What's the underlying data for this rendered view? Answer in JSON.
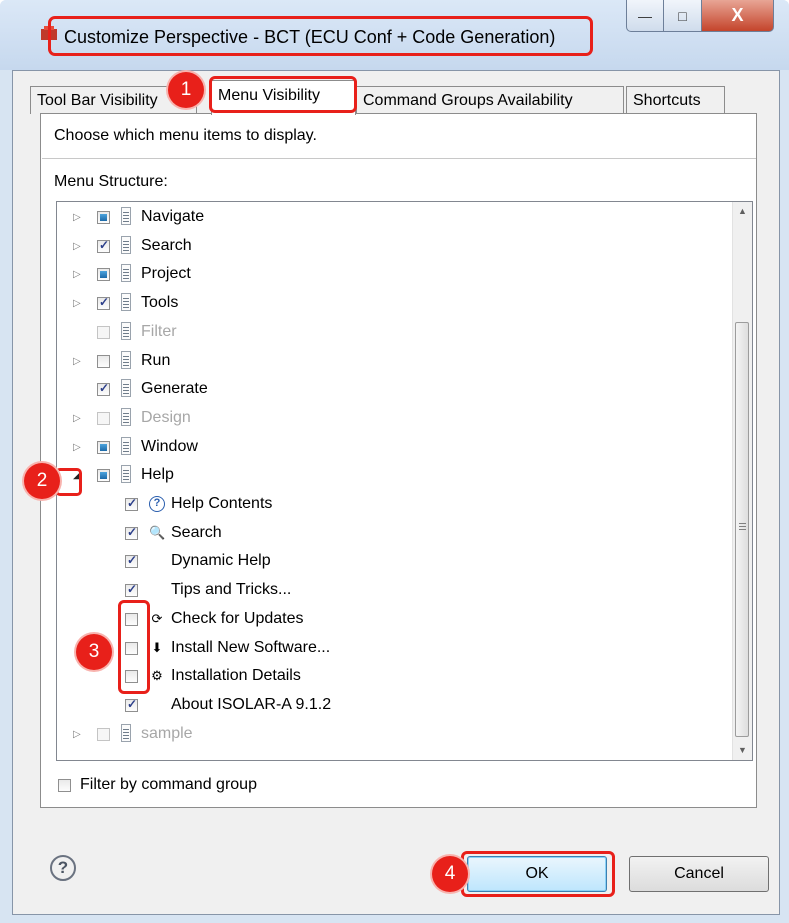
{
  "window": {
    "title": "Customize Perspective - BCT (ECU Conf + Code Generation)",
    "buttons": {
      "minimize": "—",
      "maximize": "□",
      "close": "X"
    }
  },
  "tabs": [
    {
      "label": "Tool Bar Visibility",
      "active": false
    },
    {
      "label": "Menu Visibility",
      "active": true
    },
    {
      "label": "Command Groups Availability",
      "active": false
    },
    {
      "label": "Shortcuts",
      "active": false
    }
  ],
  "panel": {
    "description": "Choose which menu items to display.",
    "structure_label": "Menu Structure:"
  },
  "tree_items": [
    {
      "label": "Navigate",
      "level": 0,
      "arrow": "collapsed",
      "state": "mixed",
      "icon": "menu-icon",
      "enabled": true
    },
    {
      "label": "Search",
      "level": 0,
      "arrow": "collapsed",
      "state": "checked",
      "icon": "menu-icon",
      "enabled": true
    },
    {
      "label": "Project",
      "level": 0,
      "arrow": "collapsed",
      "state": "mixed",
      "icon": "menu-icon",
      "enabled": true
    },
    {
      "label": "Tools",
      "level": 0,
      "arrow": "collapsed",
      "state": "checked",
      "icon": "menu-icon",
      "enabled": true
    },
    {
      "label": "Filter",
      "level": 0,
      "arrow": "none",
      "state": "unchecked",
      "icon": "menu-icon",
      "enabled": false
    },
    {
      "label": "Run",
      "level": 0,
      "arrow": "collapsed",
      "state": "unchecked",
      "icon": "menu-icon",
      "enabled": true
    },
    {
      "label": "Generate",
      "level": 0,
      "arrow": "none",
      "state": "checked",
      "icon": "menu-icon",
      "enabled": true
    },
    {
      "label": "Design",
      "level": 0,
      "arrow": "collapsed",
      "state": "unchecked",
      "icon": "menu-icon",
      "enabled": false
    },
    {
      "label": "Window",
      "level": 0,
      "arrow": "collapsed",
      "state": "mixed",
      "icon": "menu-icon",
      "enabled": true
    },
    {
      "label": "Help",
      "level": 0,
      "arrow": "expanded",
      "state": "mixed",
      "icon": "menu-icon",
      "enabled": true
    },
    {
      "label": "Help Contents",
      "level": 1,
      "arrow": "none",
      "state": "checked",
      "icon": "help-icon",
      "enabled": true
    },
    {
      "label": "Search",
      "level": 1,
      "arrow": "none",
      "state": "checked",
      "icon": "search-icon",
      "enabled": true
    },
    {
      "label": "Dynamic Help",
      "level": 1,
      "arrow": "none",
      "state": "checked",
      "icon": "",
      "enabled": true
    },
    {
      "label": "Tips and Tricks...",
      "level": 1,
      "arrow": "none",
      "state": "checked",
      "icon": "",
      "enabled": true
    },
    {
      "label": "Check for Updates",
      "level": 1,
      "arrow": "none",
      "state": "unchecked",
      "icon": "update-icon",
      "enabled": true
    },
    {
      "label": "Install New Software...",
      "level": 1,
      "arrow": "none",
      "state": "unchecked",
      "icon": "install-icon",
      "enabled": true
    },
    {
      "label": "Installation Details",
      "level": 1,
      "arrow": "none",
      "state": "unchecked",
      "icon": "details-icon",
      "enabled": true
    },
    {
      "label": "About ISOLAR-A 9.1.2",
      "level": 1,
      "arrow": "none",
      "state": "checked",
      "icon": "",
      "enabled": true
    },
    {
      "label": "sample",
      "level": 0,
      "arrow": "collapsed",
      "state": "unchecked",
      "icon": "menu-icon",
      "enabled": false
    }
  ],
  "filter": {
    "label": "Filter by command group",
    "checked": false
  },
  "buttons": {
    "ok": "OK",
    "cancel": "Cancel",
    "help": "?"
  },
  "annotations": [
    "1",
    "2",
    "3",
    "4"
  ],
  "colors": {
    "highlight": "#e8201a",
    "ok_button": "#bee6fd"
  }
}
